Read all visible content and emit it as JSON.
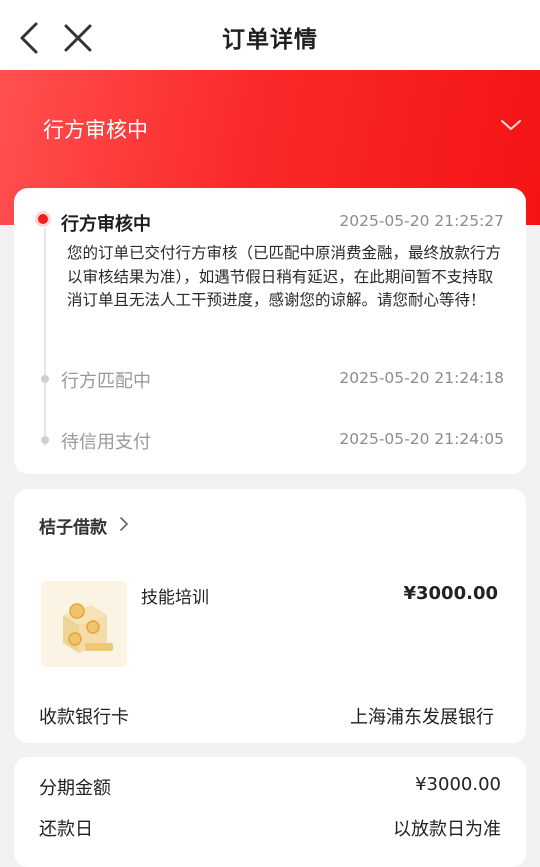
{
  "header": {
    "title": "订单详情",
    "back_icon": "chevron-left-icon",
    "close_icon": "close-icon"
  },
  "banner": {
    "status": "行方审核中",
    "expand_icon": "chevron-down-icon",
    "color": "#f52020"
  },
  "progress": {
    "steps": [
      {
        "title": "行方审核中",
        "time": "2025-05-20 21:25:27",
        "description": "您的订单已交付行方审核（已匹配中原消费金融，最终放款行方以审核结果为准），如遇节假日稍有延迟，在此期间暂不支持取消订单且无法人工干预进度，感谢您的谅解。请您耐心等待！",
        "active": true
      },
      {
        "title": "行方匹配中",
        "time": "2025-05-20 21:24:18",
        "active": false
      },
      {
        "title": "待信用支付",
        "time": "2025-05-20 21:24:05",
        "active": false
      }
    ]
  },
  "order": {
    "merchant": "桔子借款",
    "product_name": "技能培训",
    "price": "¥3000.00",
    "bank_label": "收款银行卡",
    "bank_value": "上海浦东发展银行"
  },
  "loan": {
    "amount_label": "分期金额",
    "amount_value": "¥3000.00",
    "repay_label": "还款日",
    "repay_value": "以放款日为准"
  }
}
